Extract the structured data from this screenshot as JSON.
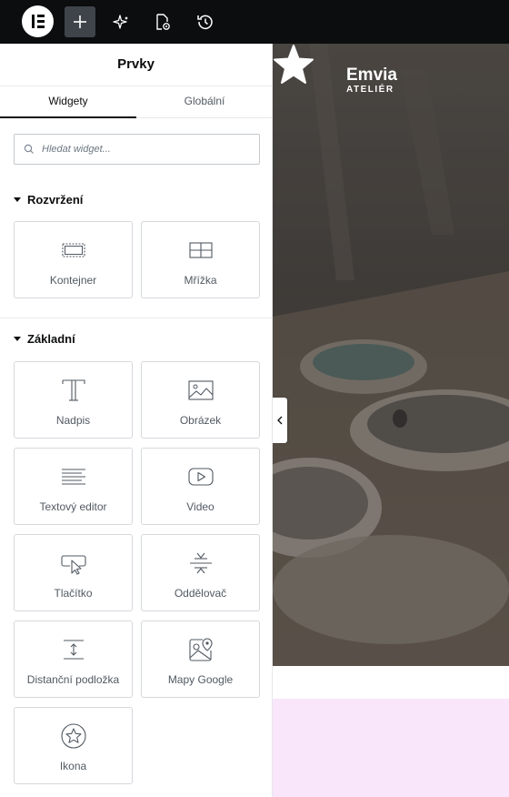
{
  "panel": {
    "title": "Prvky",
    "tabs": [
      {
        "label": "Widgety",
        "active": true
      },
      {
        "label": "Globální",
        "active": false
      }
    ],
    "search": {
      "placeholder": "Hledat widget..."
    }
  },
  "categories": [
    {
      "title": "Rozvržení",
      "widgets": [
        {
          "label": "Kontejner",
          "icon": "container-icon"
        },
        {
          "label": "Mřížka",
          "icon": "grid-icon"
        }
      ]
    },
    {
      "title": "Základní",
      "widgets": [
        {
          "label": "Nadpis",
          "icon": "heading-icon"
        },
        {
          "label": "Obrázek",
          "icon": "image-icon"
        },
        {
          "label": "Textový editor",
          "icon": "text-editor-icon"
        },
        {
          "label": "Video",
          "icon": "video-icon"
        },
        {
          "label": "Tlačítko",
          "icon": "button-icon"
        },
        {
          "label": "Oddělovač",
          "icon": "divider-icon"
        },
        {
          "label": "Distanční podložka",
          "icon": "spacer-icon"
        },
        {
          "label": "Mapy Google",
          "icon": "google-maps-icon"
        },
        {
          "label": "Ikona",
          "icon": "icon-widget-icon"
        }
      ]
    }
  ],
  "preview": {
    "brand_name": "Emvia",
    "brand_sub": "ATELIÉR"
  },
  "colors": {
    "topbar": "#0c0d0e",
    "accent_bg": "#f9e6fb",
    "active_tab": "#0c0d0e"
  }
}
